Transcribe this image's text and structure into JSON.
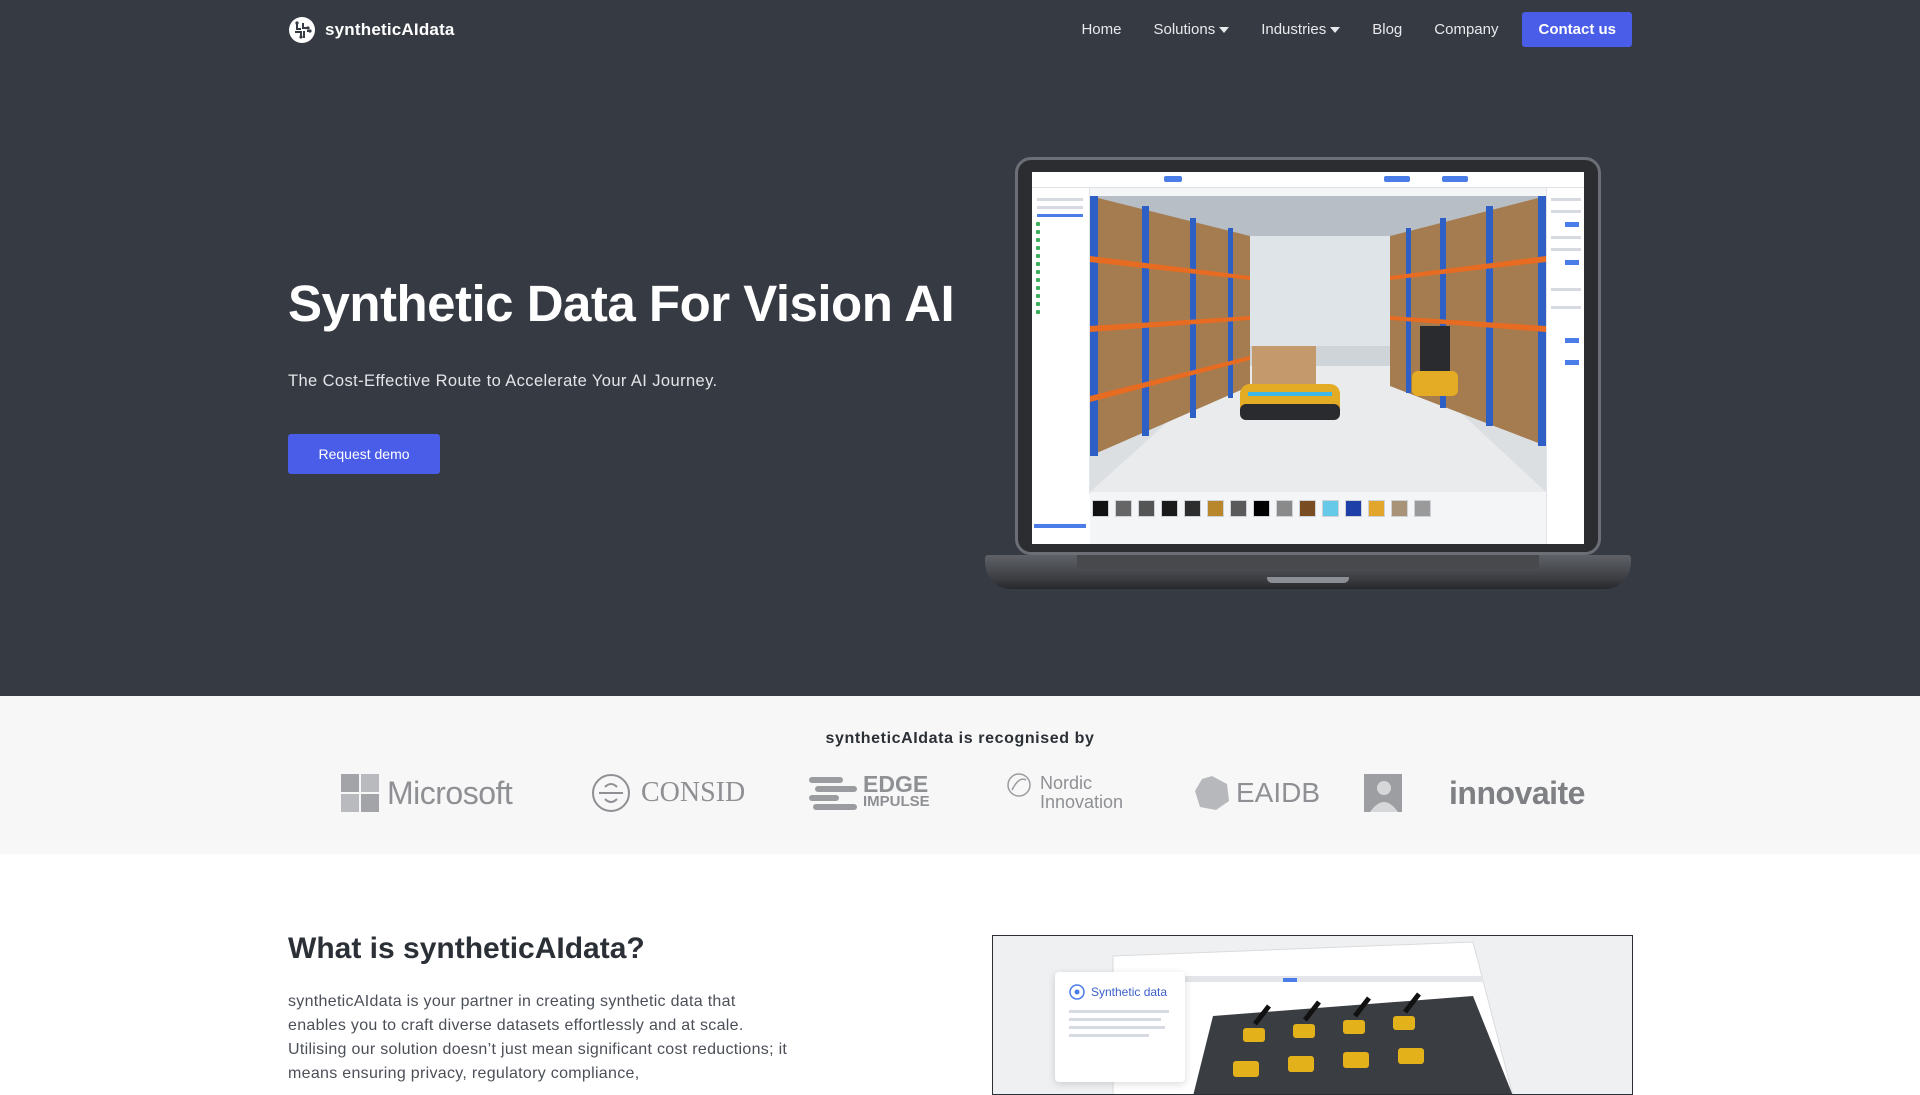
{
  "brand": {
    "name": "syntheticAIdata"
  },
  "nav": {
    "items": [
      {
        "label": "Home",
        "has_caret": false
      },
      {
        "label": "Solutions",
        "has_caret": true
      },
      {
        "label": "Industries",
        "has_caret": true
      },
      {
        "label": "Blog",
        "has_caret": false
      },
      {
        "label": "Company",
        "has_caret": false
      }
    ],
    "contact_label": "Contact us"
  },
  "hero": {
    "title": "Synthetic Data For Vision AI",
    "subtitle": "The Cost-Effective Route to Accelerate Your AI Journey.",
    "cta_label": "Request demo"
  },
  "recognition": {
    "title": "syntheticAIdata is recognised by",
    "logos": [
      {
        "name": "Microsoft",
        "text": "Microsoft"
      },
      {
        "name": "Consid",
        "text": "CONSID"
      },
      {
        "name": "Edge Impulse",
        "text_1": "EDGE",
        "text_2": "IMPULSE"
      },
      {
        "name": "Nordic Innovation",
        "text_1": "Nordic",
        "text_2": "Innovation"
      },
      {
        "name": "EAIDB",
        "text": "EAIDB"
      },
      {
        "name": "portrait-badge",
        "text": ""
      },
      {
        "name": "Innovaite",
        "text": "innovaite"
      }
    ]
  },
  "what": {
    "title": "What is syntheticAIdata?",
    "body": "syntheticAIdata is your partner in creating synthetic data that enables you to craft diverse datasets effortlessly and at scale. Utilising our solution doesn’t just mean significant cost reductions; it means ensuring privacy, regulatory compliance,",
    "media_card_title": "Synthetic data"
  },
  "colors": {
    "hero_bg": "#363a42",
    "accent": "#4a5de8",
    "recog_bg": "#f7f7f7"
  }
}
